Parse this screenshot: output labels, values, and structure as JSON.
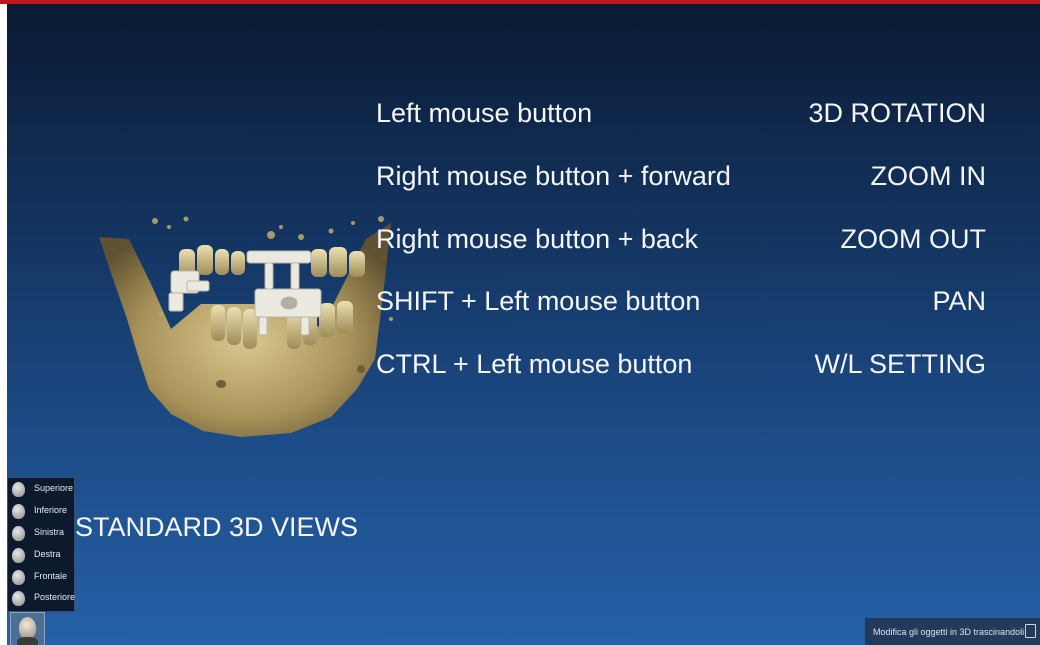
{
  "commands": [
    {
      "label": "Left mouse button",
      "action": "3D ROTATION"
    },
    {
      "label": "Right mouse button + forward",
      "action": "ZOOM IN"
    },
    {
      "label": "Right mouse button + back",
      "action": "ZOOM OUT"
    },
    {
      "label": "SHIFT + Left mouse button",
      "action": "PAN"
    },
    {
      "label": "CTRL + Left mouse button",
      "action": "W/L SETTING"
    }
  ],
  "views": {
    "title": "STANDARD 3D VIEWS",
    "items": [
      "Superiore",
      "Inferiore",
      "Sinistra",
      "Destra",
      "Frontale",
      "Posteriore"
    ]
  },
  "status": {
    "text": "Modifica gli oggetti in 3D trascinandoli"
  },
  "colors": {
    "accent_bar": "#c0151b",
    "bone": "#c9b47a",
    "implant": "#e8e6df",
    "background_top": "#0a1a33",
    "background_bottom": "#2560a8"
  }
}
